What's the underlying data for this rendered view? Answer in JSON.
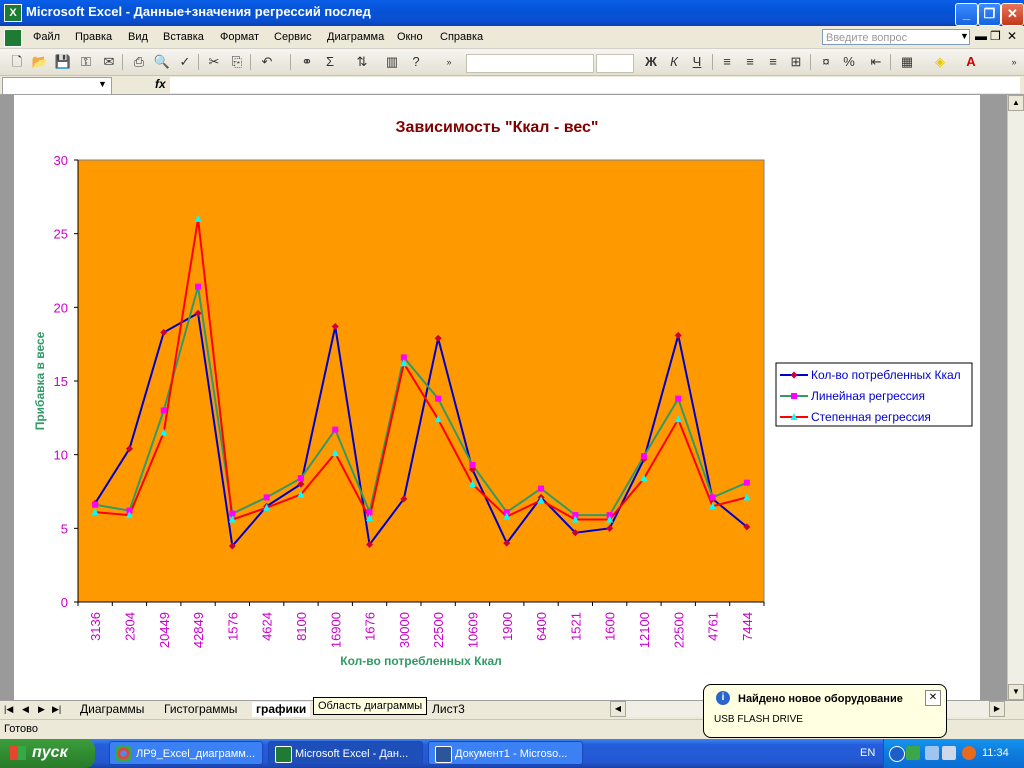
{
  "window": {
    "title": "Microsoft Excel - Данные+значения регрессий послед",
    "app_icon": "excel-icon",
    "buttons": [
      "_",
      "❐",
      "✕"
    ]
  },
  "menu": {
    "items": [
      "Файл",
      "Правка",
      "Вид",
      "Вставка",
      "Формат",
      "Сервис",
      "Диаграмма",
      "Окно",
      "Справка"
    ],
    "help_placeholder": "Введите вопрос"
  },
  "formula_bar": {
    "fx_label": "fx",
    "name_value": "",
    "formula_value": ""
  },
  "sheet_tabs": {
    "tabs": [
      "Диаграммы",
      "Гистограммы",
      "графики",
      "Лист3"
    ],
    "active": "графики",
    "tooltip": "Область диаграммы"
  },
  "status": {
    "text": "Готово"
  },
  "notification": {
    "title": "Найдено новое оборудование",
    "text": "USB FLASH DRIVE"
  },
  "taskbar": {
    "start_label": "пуск",
    "tasks": [
      "ЛР9_Excel_диаграмм...",
      "Microsoft Excel - Дан...",
      "Документ1 - Microso..."
    ],
    "lang": "EN",
    "time": "11:34"
  },
  "chart_data": {
    "type": "line",
    "title": "Зависимость \"Ккал - вес\"",
    "xlabel": "Кол-во потребленных Ккал",
    "ylabel": "Прибавка в весе",
    "categories": [
      "3136",
      "2304",
      "20449",
      "42849",
      "1576",
      "4624",
      "8100",
      "16900",
      "1676",
      "30000",
      "22500",
      "10609",
      "1900",
      "6400",
      "1521",
      "1600",
      "12100",
      "22500",
      "4761",
      "7444"
    ],
    "ylim": [
      0,
      30
    ],
    "yticks": [
      0,
      5,
      10,
      15,
      20,
      25,
      30
    ],
    "legend_position": "right",
    "plot_background": "#ff9900",
    "title_color": "#800000",
    "axis_label_color": "#339966",
    "tick_color": "#cc00cc",
    "series": [
      {
        "name": "Кол-во потребленных Ккал",
        "color": "#0000cc",
        "marker_color": "#cc0033",
        "marker": "diamond",
        "values": [
          6.7,
          10.4,
          18.3,
          19.6,
          3.8,
          6.5,
          8.0,
          18.7,
          3.9,
          7.0,
          17.9,
          9.0,
          4.0,
          7.1,
          4.7,
          5.0,
          9.7,
          18.1,
          7.0,
          5.1
        ]
      },
      {
        "name": "Линейная регрессия",
        "color": "#339966",
        "marker_color": "#ff00ff",
        "marker": "square",
        "values": [
          6.6,
          6.2,
          13.0,
          21.4,
          6.0,
          7.1,
          8.4,
          11.7,
          6.1,
          16.6,
          13.8,
          9.3,
          6.1,
          7.7,
          5.9,
          5.9,
          9.9,
          13.8,
          7.1,
          8.1
        ]
      },
      {
        "name": "Степенная регрессия",
        "color": "#ff0000",
        "marker_color": "#00ffff",
        "marker": "triangle",
        "values": [
          6.1,
          5.9,
          11.5,
          26.0,
          5.6,
          6.4,
          7.3,
          10.1,
          5.7,
          16.2,
          12.4,
          8.0,
          5.8,
          6.9,
          5.6,
          5.6,
          8.4,
          12.4,
          6.5,
          7.1
        ]
      }
    ]
  }
}
